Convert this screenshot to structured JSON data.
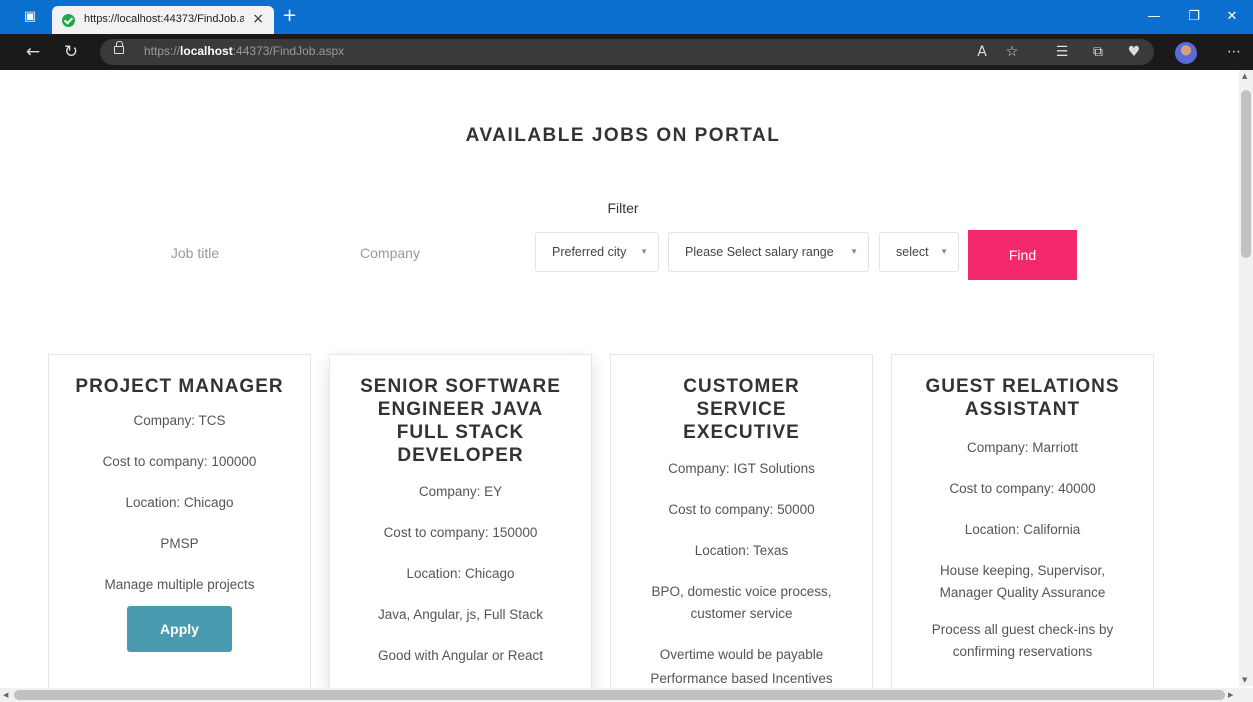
{
  "browser": {
    "tab_title": "https://localhost:44373/FindJob.aspx",
    "new_tab": "+",
    "close_tab": "×",
    "url_scheme": "https://",
    "url_host": "localhost",
    "url_rest": ":44373/FindJob.aspx",
    "controls": {
      "minimize": "—",
      "restore": "❐",
      "close": "✕"
    }
  },
  "page": {
    "heading": "AVAILABLE JOBS ON PORTAL",
    "filter": {
      "label": "Filter",
      "job_title_placeholder": "Job title",
      "company_placeholder": "Company",
      "city_select": "Preferred city",
      "salary_select": "Please Select salary range",
      "extra_select": "select",
      "find_label": "Find"
    },
    "jobs": [
      {
        "title": "PROJECT MANAGER",
        "company": "Company: TCS",
        "cost": "Cost to company: 100000",
        "location": "Location: Chicago",
        "skills": "PMSP",
        "description": "Manage multiple projects",
        "extra": "",
        "apply_label": "Apply"
      },
      {
        "title": "SENIOR SOFTWARE ENGINEER JAVA FULL STACK DEVELOPER",
        "company": "Company: EY",
        "cost": "Cost to company: 150000",
        "location": "Location: Chicago",
        "skills": "Java, Angular, js, Full Stack",
        "description": "Good with Angular or React",
        "extra": ""
      },
      {
        "title": "CUSTOMER SERVICE EXECUTIVE",
        "company": "Company: IGT Solutions",
        "cost": "Cost to company: 50000",
        "location": "Location: Texas",
        "skills": "BPO, domestic voice process, customer service",
        "description": "Overtime would be payable",
        "extra": "Performance based Incentives"
      },
      {
        "title": "GUEST RELATIONS ASSISTANT",
        "company": "Company: Marriott",
        "cost": "Cost to company: 40000",
        "location": "Location: California",
        "skills": "House keeping, Supervisor, Manager Quality Assurance",
        "description": "Process all guest check-ins by confirming reservations",
        "extra": ""
      }
    ]
  },
  "colors": {
    "find_button": "#f4286c",
    "apply_button": "#4a9bb0",
    "titlebar": "#0b6fd0"
  }
}
